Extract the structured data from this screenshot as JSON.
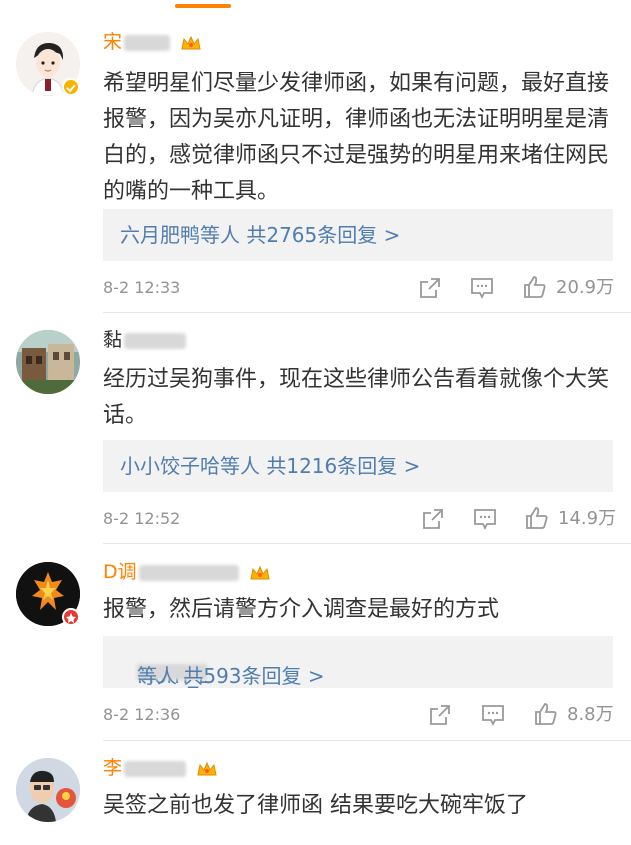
{
  "comments": [
    {
      "username": "宋",
      "text": "希望明星们尽量少发律师函，如果有问题，最好直接报警，因为吴亦凡证明，律师函也无法证明明星是清白的，感觉律师函只不过是强势的明星用来堵住网民的嘴的一种工具。",
      "reply_summary": "六月肥鸭等人  共2765条回复 >",
      "time": "8-2 12:33",
      "likes": "20.9万"
    },
    {
      "username": "黏",
      "text": "经历过吴狗事件，现在这些律师公告看着就像个大笑话。",
      "reply_summary": "小小饺子哈等人  共1216条回复 >",
      "time": "8-2 12:52",
      "likes": "14.9万"
    },
    {
      "username": "D调",
      "text": "报警，然后请警方介入调查是最好的方式",
      "reply_prefix": "Morri_L",
      "reply_suffix": "等人  共593条回复 >",
      "time": "8-2 12:36",
      "likes": "8.8万"
    },
    {
      "username": "李",
      "text": "吴签之前也发了律师函 结果要吃大碗牢饭了"
    }
  ],
  "colors": {
    "accent": "#ff8200",
    "link": "#507daf",
    "meta": "#939393"
  },
  "icons": [
    "share-icon",
    "comment-icon",
    "like-icon",
    "crown-icon",
    "verified-badge-icon"
  ]
}
